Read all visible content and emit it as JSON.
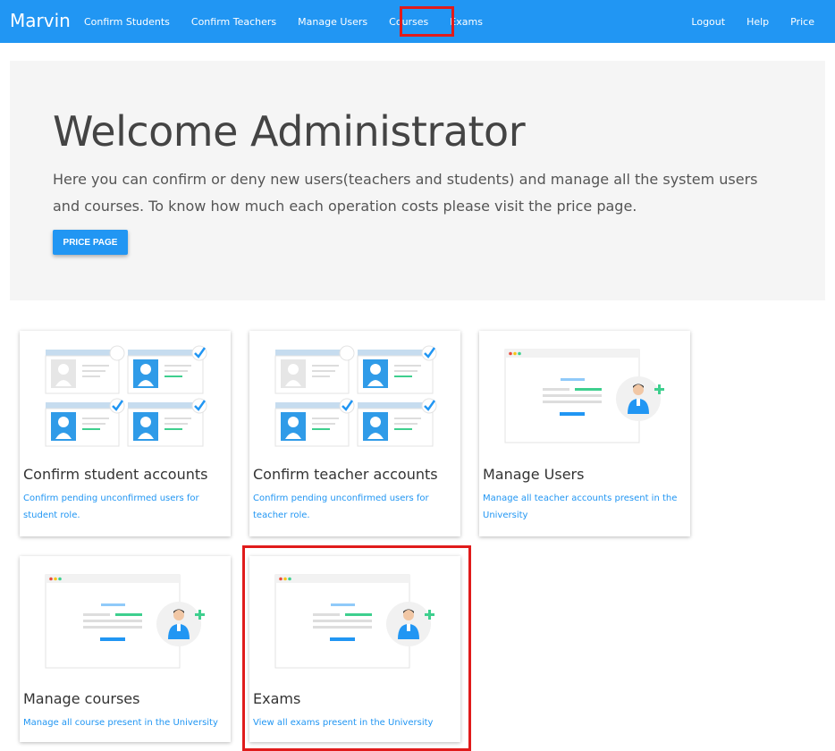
{
  "navbar": {
    "brand": "Marvin",
    "left_links": [
      "Confirm Students",
      "Confirm Teachers",
      "Manage Users",
      "Courses",
      "Exams"
    ],
    "right_links": [
      "Logout",
      "Help",
      "Price"
    ],
    "active": "Exams"
  },
  "jumbotron": {
    "title": "Welcome Administrator",
    "lead": "Here you can confirm or deny new users(teachers and students) and manage all the system users and courses. To know how much each operation costs please visit the price page.",
    "button_label": "PRICE PAGE"
  },
  "cards": [
    {
      "title": "Confirm student accounts",
      "description": "Confirm pending unconfirmed users for student role.",
      "illustration": "user-grid-illustration"
    },
    {
      "title": "Confirm teacher accounts",
      "description": "Confirm pending unconfirmed users for teacher role.",
      "illustration": "user-grid-illustration"
    },
    {
      "title": "Manage Users",
      "description": "Manage all teacher accounts present in the University",
      "illustration": "add-user-window-illustration"
    },
    {
      "title": "Manage courses",
      "description": "Manage all course present in the University",
      "illustration": "add-user-window-illustration"
    },
    {
      "title": "Exams",
      "description": "View all exams present in the University",
      "illustration": "add-user-window-illustration"
    }
  ],
  "colors": {
    "primary": "#2196f3",
    "highlight": "#e01b1b",
    "jumbo_bg": "#f5f5f5",
    "green": "#3ecf8e"
  }
}
